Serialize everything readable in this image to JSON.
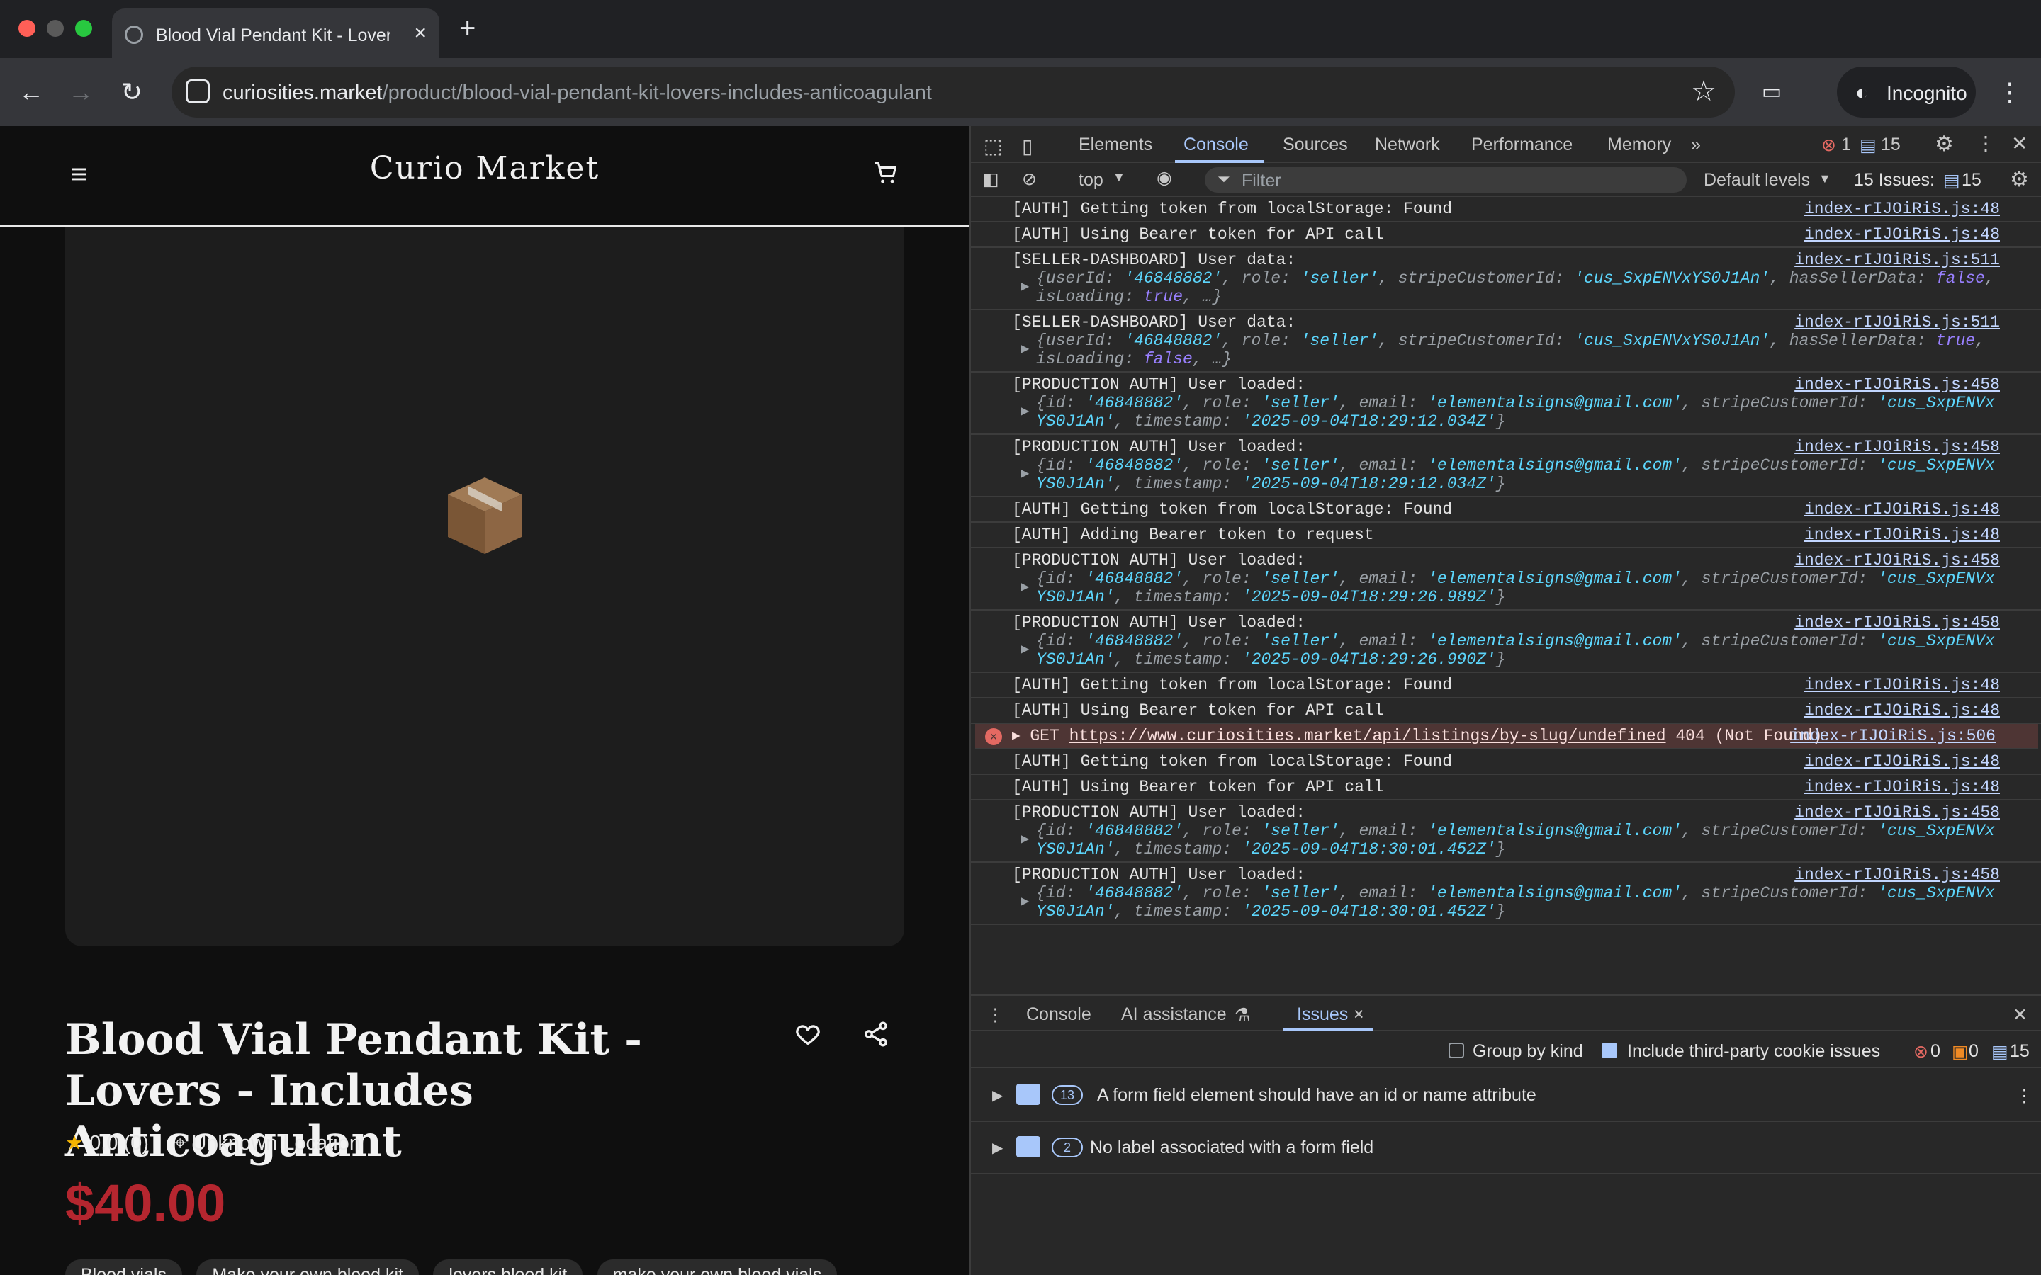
{
  "browser": {
    "tab_title": "Blood Vial Pendant Kit - Lovers",
    "url_domain": "curiosities.market",
    "url_path": "/product/blood-vial-pendant-kit-lovers-includes-anticoagulant",
    "incognito_label": "Incognito"
  },
  "site": {
    "logo": "Curio Market",
    "product": {
      "title": "Blood Vial Pendant Kit - Lovers - Includes Anticoagulant",
      "rating": "0.0 (0)",
      "location": "Unknown Location",
      "price": "$40.00",
      "tags": [
        "Blood vials",
        "Make your own blood kit",
        "lovers blood kit",
        "make your own blood vials"
      ]
    }
  },
  "devtools": {
    "tabs": [
      "Elements",
      "Console",
      "Sources",
      "Network",
      "Performance",
      "Memory"
    ],
    "active_tab": "Console",
    "error_count": "1",
    "message_count": "15",
    "context": "top",
    "filter_placeholder": "Filter",
    "levels": "Default levels",
    "issues_summary": "15 Issues:",
    "issues_count": "15",
    "logs": [
      {
        "type": "text",
        "text": "[AUTH] Getting token from localStorage: Found",
        "src": "index-rIJOiRiS.js:48"
      },
      {
        "type": "text",
        "text": "[AUTH] Using Bearer token for API call",
        "src": "index-rIJOiRiS.js:48"
      },
      {
        "type": "obj",
        "text": "[SELLER-DASHBOARD] User data:",
        "src": "index-rIJOiRiS.js:511",
        "obj": "{userId: '46848882', role: 'seller', stripeCustomerId: 'cus_SxpENVxYS0J1An', hasSellerData: false, isLoading: true, …}"
      },
      {
        "type": "obj",
        "text": "[SELLER-DASHBOARD] User data:",
        "src": "index-rIJOiRiS.js:511",
        "obj": "{userId: '46848882', role: 'seller', stripeCustomerId: 'cus_SxpENVxYS0J1An', hasSellerData: true, isLoading: false, …}"
      },
      {
        "type": "obj",
        "text": "[PRODUCTION AUTH] User loaded:",
        "src": "index-rIJOiRiS.js:458",
        "obj": "{id: '46848882', role: 'seller', email: 'elementalsigns@gmail.com', stripeCustomerId: 'cus_SxpENVxYS0J1An', timestamp: '2025-09-04T18:29:12.034Z'}"
      },
      {
        "type": "obj",
        "text": "[PRODUCTION AUTH] User loaded:",
        "src": "index-rIJOiRiS.js:458",
        "obj": "{id: '46848882', role: 'seller', email: 'elementalsigns@gmail.com', stripeCustomerId: 'cus_SxpENVxYS0J1An', timestamp: '2025-09-04T18:29:12.034Z'}"
      },
      {
        "type": "text",
        "text": "[AUTH] Getting token from localStorage: Found",
        "src": "index-rIJOiRiS.js:48"
      },
      {
        "type": "text",
        "text": "[AUTH] Adding Bearer token to request",
        "src": "index-rIJOiRiS.js:48"
      },
      {
        "type": "obj",
        "text": "[PRODUCTION AUTH] User loaded:",
        "src": "index-rIJOiRiS.js:458",
        "obj": "{id: '46848882', role: 'seller', email: 'elementalsigns@gmail.com', stripeCustomerId: 'cus_SxpENVxYS0J1An', timestamp: '2025-09-04T18:29:26.989Z'}"
      },
      {
        "type": "obj",
        "text": "[PRODUCTION AUTH] User loaded:",
        "src": "index-rIJOiRiS.js:458",
        "obj": "{id: '46848882', role: 'seller', email: 'elementalsigns@gmail.com', stripeCustomerId: 'cus_SxpENVxYS0J1An', timestamp: '2025-09-04T18:29:26.990Z'}"
      },
      {
        "type": "text",
        "text": "[AUTH] Getting token from localStorage: Found",
        "src": "index-rIJOiRiS.js:48"
      },
      {
        "type": "text",
        "text": "[AUTH] Using Bearer token for API call",
        "src": "index-rIJOiRiS.js:48"
      },
      {
        "type": "error",
        "text": "GET",
        "link": "https://www.curiosities.market/api/listings/by-slug/undefined",
        "status": "404 (Not Found)",
        "src": "index-rIJOiRiS.js:506"
      },
      {
        "type": "text",
        "text": "[AUTH] Getting token from localStorage: Found",
        "src": "index-rIJOiRiS.js:48"
      },
      {
        "type": "text",
        "text": "[AUTH] Using Bearer token for API call",
        "src": "index-rIJOiRiS.js:48"
      },
      {
        "type": "obj",
        "text": "[PRODUCTION AUTH] User loaded:",
        "src": "index-rIJOiRiS.js:458",
        "obj": "{id: '46848882', role: 'seller', email: 'elementalsigns@gmail.com', stripeCustomerId: 'cus_SxpENVxYS0J1An', timestamp: '2025-09-04T18:30:01.452Z'}"
      },
      {
        "type": "obj",
        "text": "[PRODUCTION AUTH] User loaded:",
        "src": "index-rIJOiRiS.js:458",
        "obj": "{id: '46848882', role: 'seller', email: 'elementalsigns@gmail.com', stripeCustomerId: 'cus_SxpENVxYS0J1An', timestamp: '2025-09-04T18:30:01.452Z'}"
      }
    ],
    "drawer": {
      "tabs": [
        "Console",
        "AI assistance",
        "Issues"
      ],
      "active_tab": "Issues",
      "group_by_kind": "Group by kind",
      "third_party": "Include third-party cookie issues",
      "counts": {
        "errors": "0",
        "warnings": "0",
        "info": "15"
      },
      "issues": [
        {
          "count": "13",
          "text": "A form field element should have an id or name attribute"
        },
        {
          "count": "2",
          "text": "No label associated with a form field"
        }
      ]
    }
  }
}
